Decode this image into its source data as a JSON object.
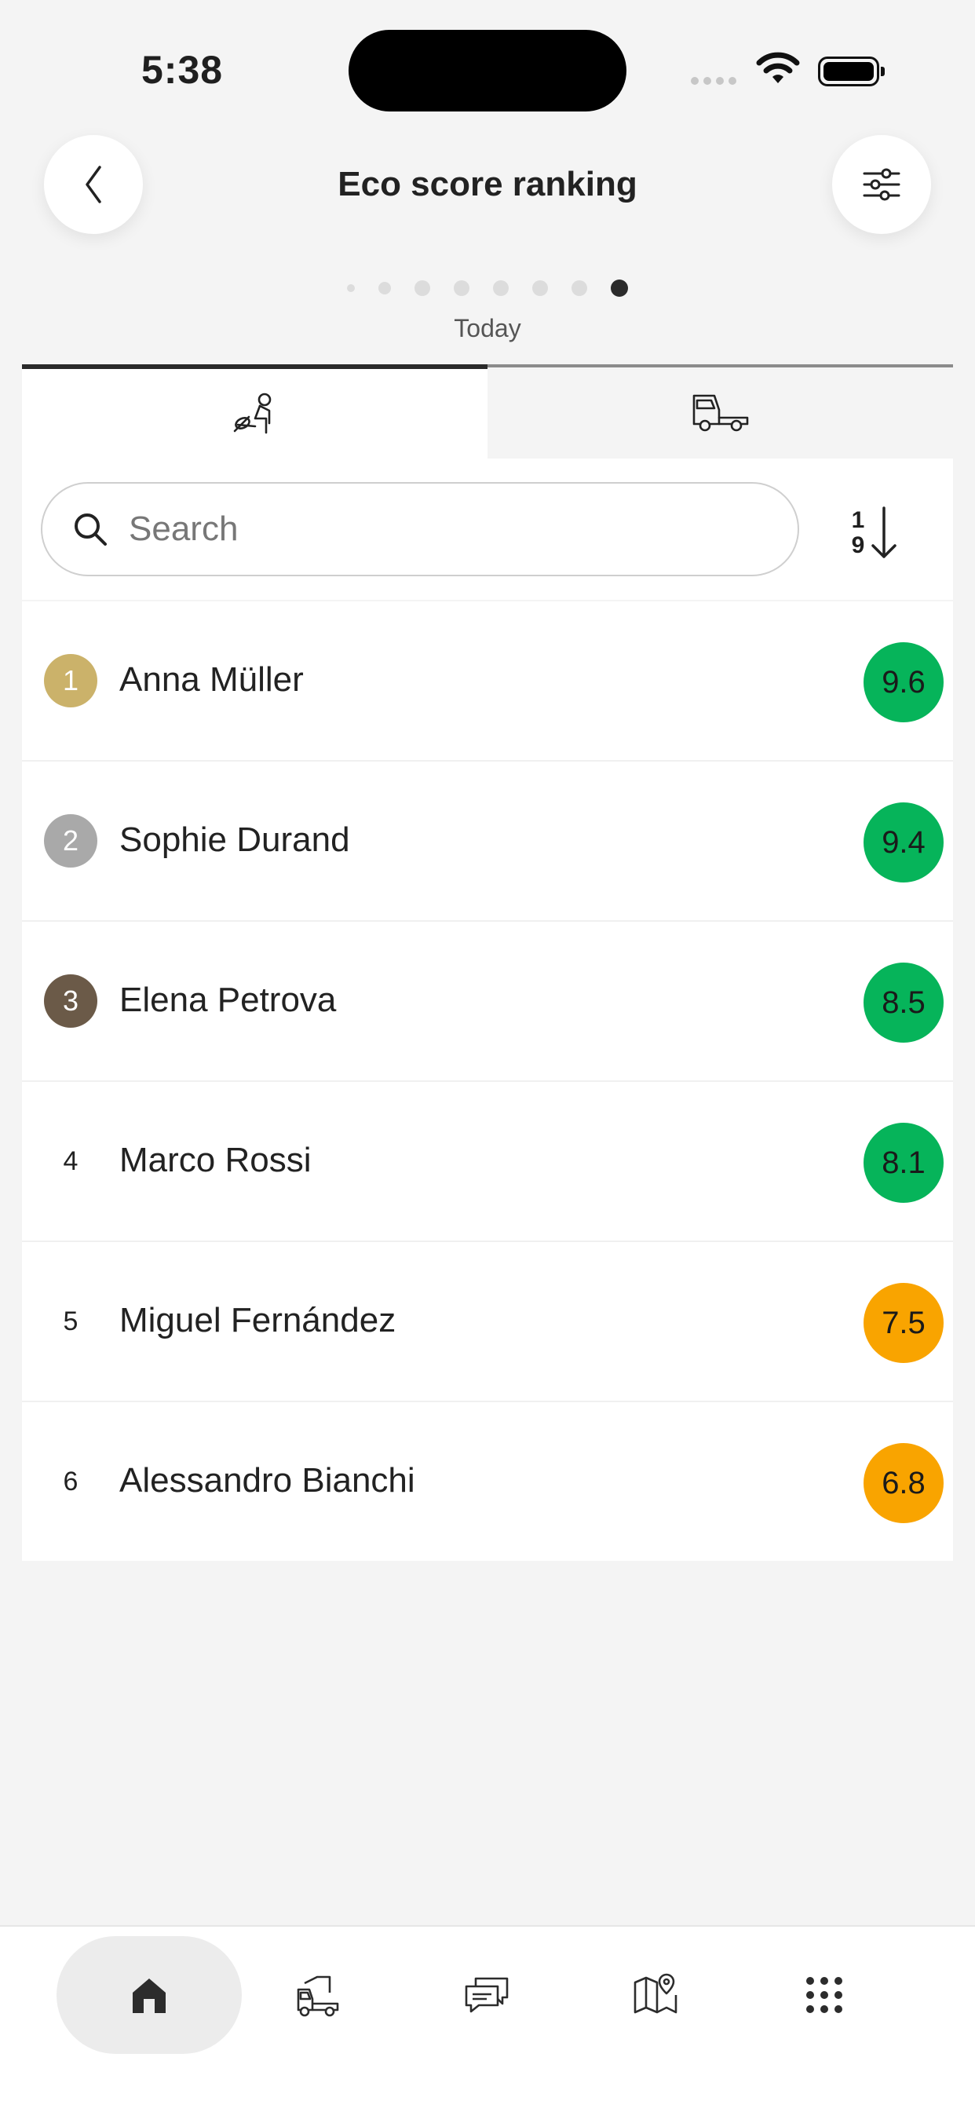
{
  "status_bar": {
    "time": "5:38"
  },
  "header": {
    "title": "Eco score ranking",
    "period": "Today",
    "dots_total": 8,
    "active_dot": 7
  },
  "tabs": [
    {
      "name": "drivers",
      "icon": "driver-icon",
      "selected": true
    },
    {
      "name": "vehicles",
      "icon": "truck-icon",
      "selected": false
    }
  ],
  "search": {
    "placeholder": "Search",
    "value": ""
  },
  "sort": {
    "top": "1",
    "bottom": "9"
  },
  "colors": {
    "gold": "#cbb26a",
    "silver": "#a9a9a9",
    "bronze": "#6b5a48",
    "green": "#06b45a",
    "orange": "#f9a400"
  },
  "ranking": [
    {
      "rank": "1",
      "name": "Anna Müller",
      "score": "9.6",
      "medal": "gold",
      "score_color": "green"
    },
    {
      "rank": "2",
      "name": "Sophie Durand",
      "score": "9.4",
      "medal": "silver",
      "score_color": "green"
    },
    {
      "rank": "3",
      "name": "Elena Petrova",
      "score": "8.5",
      "medal": "bronze",
      "score_color": "green"
    },
    {
      "rank": "4",
      "name": "Marco Rossi",
      "score": "8.1",
      "medal": "",
      "score_color": "green"
    },
    {
      "rank": "5",
      "name": "Miguel Fernández",
      "score": "7.5",
      "medal": "",
      "score_color": "orange"
    },
    {
      "rank": "6",
      "name": "Alessandro Bianchi",
      "score": "6.8",
      "medal": "",
      "score_color": "orange"
    }
  ],
  "bottom_nav": [
    {
      "icon": "home-icon",
      "active": true
    },
    {
      "icon": "truck-trailer-icon",
      "active": false
    },
    {
      "icon": "messages-icon",
      "active": false
    },
    {
      "icon": "map-icon",
      "active": false
    },
    {
      "icon": "apps-grid-icon",
      "active": false
    }
  ]
}
